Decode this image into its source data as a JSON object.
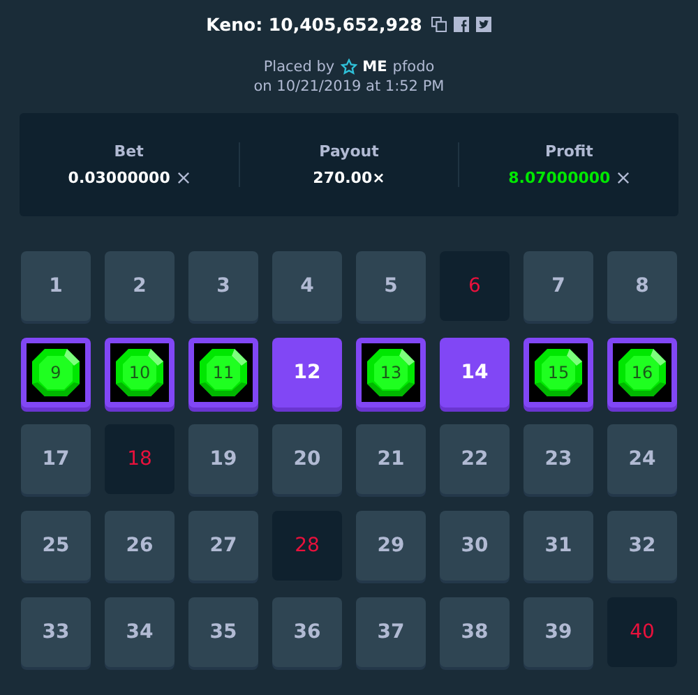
{
  "title": "Keno: 10,405,652,928",
  "placed": {
    "prefix": "Placed by",
    "rank": "ME",
    "user": "pfodo",
    "date": "on 10/21/2019 at 1:52 PM"
  },
  "stats": [
    {
      "label": "Bet",
      "value": "0.03000000",
      "kind": "currency",
      "positive": false
    },
    {
      "label": "Payout",
      "value": "270.00×",
      "kind": "plain",
      "positive": false
    },
    {
      "label": "Profit",
      "value": "8.07000000",
      "kind": "currency",
      "positive": true
    }
  ],
  "tiles": [
    {
      "number": "1",
      "kind": "idle"
    },
    {
      "number": "2",
      "kind": "idle"
    },
    {
      "number": "3",
      "kind": "idle"
    },
    {
      "number": "4",
      "kind": "idle"
    },
    {
      "number": "5",
      "kind": "idle"
    },
    {
      "number": "6",
      "kind": "drawn"
    },
    {
      "number": "7",
      "kind": "idle"
    },
    {
      "number": "8",
      "kind": "idle"
    },
    {
      "number": "9",
      "kind": "hit"
    },
    {
      "number": "10",
      "kind": "hit"
    },
    {
      "number": "11",
      "kind": "hit"
    },
    {
      "number": "12",
      "kind": "picked"
    },
    {
      "number": "13",
      "kind": "hit"
    },
    {
      "number": "14",
      "kind": "picked"
    },
    {
      "number": "15",
      "kind": "hit"
    },
    {
      "number": "16",
      "kind": "hit"
    },
    {
      "number": "17",
      "kind": "idle"
    },
    {
      "number": "18",
      "kind": "drawn"
    },
    {
      "number": "19",
      "kind": "idle"
    },
    {
      "number": "20",
      "kind": "idle"
    },
    {
      "number": "21",
      "kind": "idle"
    },
    {
      "number": "22",
      "kind": "idle"
    },
    {
      "number": "23",
      "kind": "idle"
    },
    {
      "number": "24",
      "kind": "idle"
    },
    {
      "number": "25",
      "kind": "idle"
    },
    {
      "number": "26",
      "kind": "idle"
    },
    {
      "number": "27",
      "kind": "idle"
    },
    {
      "number": "28",
      "kind": "drawn"
    },
    {
      "number": "29",
      "kind": "idle"
    },
    {
      "number": "30",
      "kind": "idle"
    },
    {
      "number": "31",
      "kind": "idle"
    },
    {
      "number": "32",
      "kind": "idle"
    },
    {
      "number": "33",
      "kind": "idle"
    },
    {
      "number": "34",
      "kind": "idle"
    },
    {
      "number": "35",
      "kind": "idle"
    },
    {
      "number": "36",
      "kind": "idle"
    },
    {
      "number": "37",
      "kind": "idle"
    },
    {
      "number": "38",
      "kind": "idle"
    },
    {
      "number": "39",
      "kind": "idle"
    },
    {
      "number": "40",
      "kind": "drawn"
    }
  ]
}
